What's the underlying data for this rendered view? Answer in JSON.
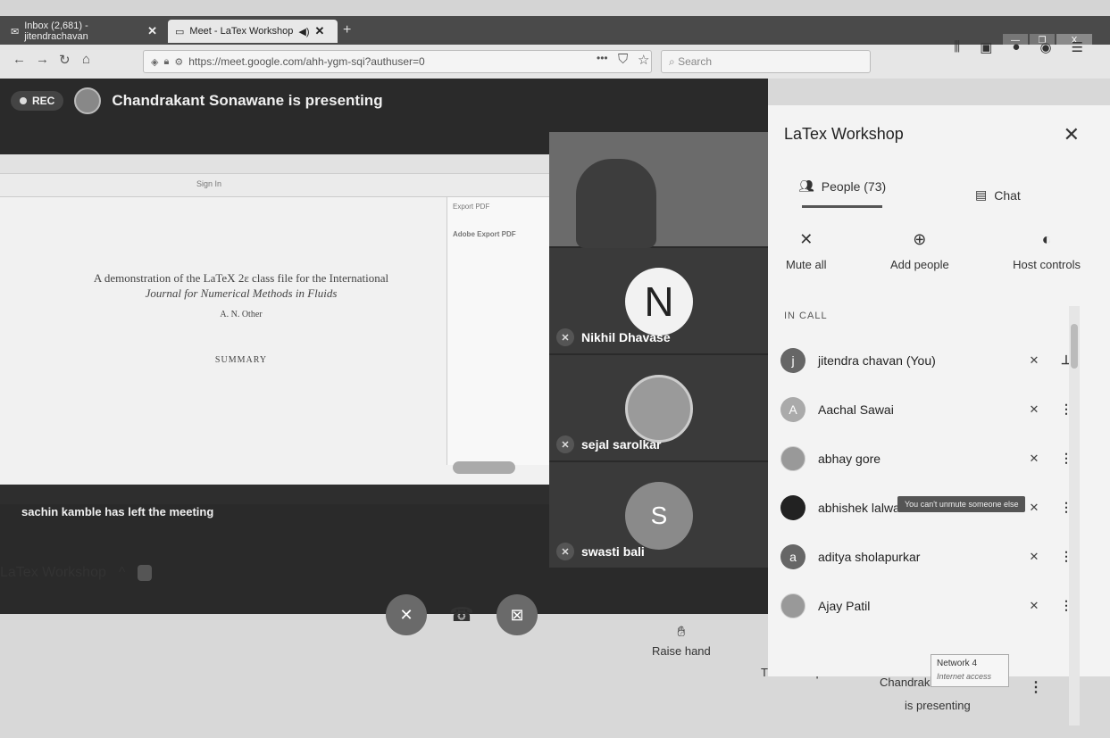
{
  "browser": {
    "tabs": [
      {
        "title": "Inbox (2,681) - jitendrachavan",
        "close": "✕"
      },
      {
        "title": "Meet - LaTex Workshop",
        "close": "✕"
      }
    ],
    "new_tab": "+",
    "url": "https://meet.google.com/ahh-ygm-sqi?authuser=0",
    "url_domain_hint": "meet.google.com",
    "search_placeholder": "Search",
    "window_controls": [
      "—",
      "❐",
      "X"
    ]
  },
  "meeting": {
    "rec_label": "REC",
    "presenting_title": "Chandrakant Sonawane is presenting",
    "left_notice": "sachin kamble has left the meeting",
    "meeting_name_bottom": "LaTex Workshop",
    "shared_doc": {
      "title_line1": "A demonstration of the LaTeX 2ε class file for the International",
      "title_line2": "Journal for Numerical Methods in Fluids",
      "author": "A. N. Other",
      "summary_heading": "SUMMARY",
      "search_tab_text": "Sign In",
      "side_heading": "Adobe Export PDF",
      "side_button": "Export PDF"
    },
    "tiles": [
      {
        "name": "",
        "type": "video"
      },
      {
        "name": "Nikhil Dhavase",
        "initial": "N",
        "type": "letter"
      },
      {
        "name": "sejal sarolkar",
        "type": "photo"
      },
      {
        "name": "swasti bali",
        "initial": "S",
        "type": "grey"
      }
    ],
    "actions": {
      "raise_hand": "Raise hand",
      "captions": "Turn on captions",
      "presenting_line1": "Chandrakant",
      "presenting_line2": "is presenting"
    },
    "network": {
      "line1": "Network 4",
      "line2": "Internet access"
    }
  },
  "panel": {
    "title": "LaTex Workshop",
    "tabs": {
      "people": "People (73)",
      "chat": "Chat"
    },
    "tools": {
      "mute_all": "Mute all",
      "add_people": "Add people",
      "host_controls": "Host controls"
    },
    "in_call_label": "IN CALL",
    "participants": [
      {
        "name": "jitendra chavan (You)",
        "initial": "j",
        "avatar": "dark-grey"
      },
      {
        "name": "Aachal Sawai",
        "initial": "A",
        "avatar": "light-grey"
      },
      {
        "name": "abhay gore",
        "initial": "",
        "avatar": "photo"
      },
      {
        "name": "abhishek lalwani",
        "initial": "",
        "avatar": "black"
      },
      {
        "name": "aditya sholapurkar",
        "initial": "a",
        "avatar": "dark-grey"
      },
      {
        "name": "Ajay Patil",
        "initial": "",
        "avatar": "photo"
      }
    ],
    "tooltip": "You can't unmute someone else"
  }
}
